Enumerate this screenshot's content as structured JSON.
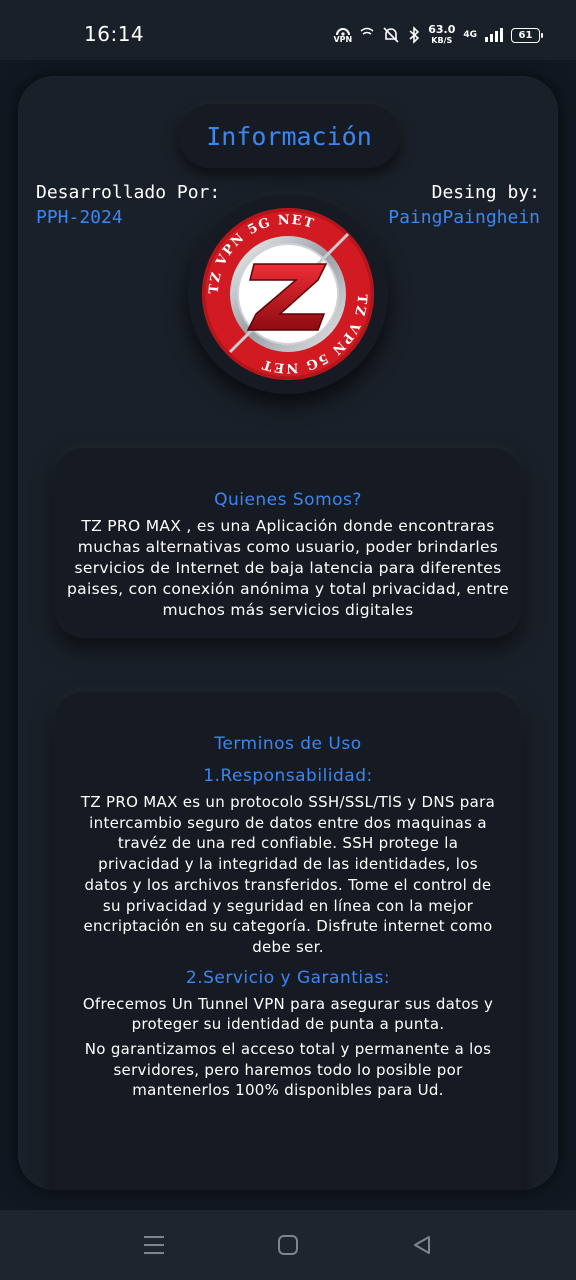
{
  "status_bar": {
    "time": "16:14",
    "vpn_label": "VPN",
    "speed_value": "63.0",
    "speed_unit": "KB/S",
    "network_label": "4G",
    "battery": "61"
  },
  "header": {
    "title": "Información",
    "developed_label": "Desarrollado Por:",
    "developed_value": "PPH-2024",
    "design_label": "Desing by:",
    "design_value": "PaingPainghein"
  },
  "logo": {
    "ring_text": "TZ VPN 5G NET",
    "letter": "Z"
  },
  "about": {
    "heading": "Quienes Somos?",
    "text": "TZ PRO MAX , es una Aplicación donde encontraras muchas alternativas como usuario, poder brindarles servicios de Internet de baja latencia para diferentes paises, con conexión anónima y total privacidad, entre muchos más servicios digitales"
  },
  "terms": {
    "heading": "Terminos de Uso",
    "section1_title": "1.Responsabilidad:",
    "section1_text": "TZ PRO MAX  es un protocolo SSH/SSL/TlS y DNS para intercambio seguro de datos entre dos maquinas a travéz de una red confiable. SSH protege la privacidad y la integridad de las identidades, los datos y los archivos transferidos. Tome el control de su privacidad y seguridad en línea con la mejor encriptación en su categoría. Disfrute internet como debe ser.",
    "section2_title": "2.Servicio y Garantias:",
    "section2_text_a": "Ofrecemos Un Tunnel VPN para asegurar sus datos y proteger su identidad de punta a punta.",
    "section2_text_b": "No garantizamos el acceso total y permanente a los servidores, pero haremos todo lo posible por mantenerlos 100% disponibles para Ud."
  },
  "colors": {
    "accent": "#3b86f0",
    "background": "#121822",
    "card": "#1a2029",
    "logo_red": "#d11a22"
  },
  "nav": {
    "icons": [
      "menu-icon",
      "home-icon",
      "back-icon"
    ]
  }
}
